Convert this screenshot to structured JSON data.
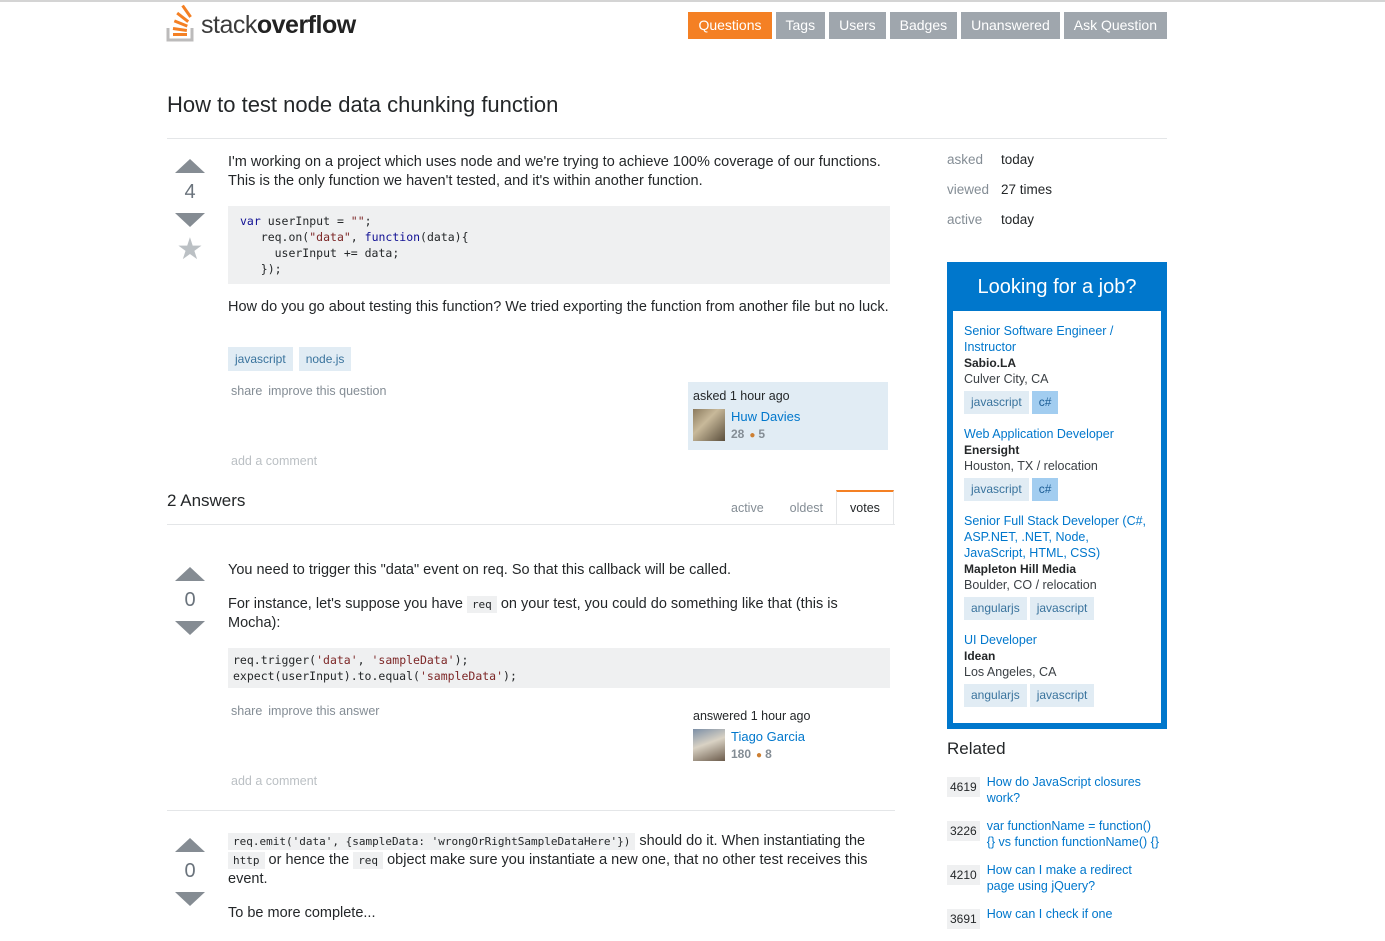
{
  "header": {
    "logo": {
      "light": "stack",
      "bold": "overflow"
    },
    "nav": [
      "Questions",
      "Tags",
      "Users",
      "Badges",
      "Unanswered",
      "Ask Question"
    ],
    "nav_active": "Questions"
  },
  "question": {
    "title": "How to test node data chunking function",
    "votes": "4",
    "body_p1": "I'm working on a project which uses node and we're trying to achieve 100% coverage of our functions. This is the only function we haven't tested, and it's within another function.",
    "code_lines": [
      "var userInput = \"\";",
      "   req.on(\"data\", function(data){",
      "     userInput += data;",
      "   });"
    ],
    "body_p2": "How do you go about testing this function? We tried exporting the function from another file but no luck.",
    "tags": [
      "javascript",
      "node.js"
    ],
    "menu": [
      "share",
      "improve this question"
    ],
    "asked_label": "asked",
    "asked_time": "1 hour ago",
    "user": {
      "name": "Huw Davies",
      "rep": "28",
      "bronze": "5"
    },
    "add_comment": "add a comment"
  },
  "answers_header": {
    "count_label": "2 Answers",
    "tabs": [
      "active",
      "oldest",
      "votes"
    ],
    "active_tab": "votes"
  },
  "answer1": {
    "votes": "0",
    "p1": "You need to trigger this \"data\" event on req. So that this callback will be called.",
    "p2_before": "For instance, let's suppose you have",
    "p2_code": "req",
    "p2_after": "on your test, you could do something like that (this is Mocha):",
    "code_lines": [
      "req.trigger('data', 'sampleData');",
      "expect(userInput).to.equal('sampleData');"
    ],
    "menu": [
      "share",
      "improve this answer"
    ],
    "answered_label": "answered",
    "answered_time": "1 hour ago",
    "user": {
      "name": "Tiago Garcia",
      "rep": "180",
      "bronze": "8"
    },
    "add_comment": "add a comment"
  },
  "answer2": {
    "votes": "0",
    "code1": "req.emit('data', {sampleData: 'wrongOrRightSampleDataHere'})",
    "t1": "should do it. When instantiating the",
    "code2": "http",
    "t2": "or hence the",
    "code3": "req",
    "t3": "object make sure you instantiate a new one, that no other test receives this event.",
    "p2": "To be more complete..."
  },
  "sidebar": {
    "info": [
      {
        "label": "asked",
        "value": "today"
      },
      {
        "label": "viewed",
        "value": "27 times"
      },
      {
        "label": "active",
        "value": "today"
      }
    ],
    "jobs_title": "Looking for a job?",
    "jobs": [
      {
        "title": "Senior Software Engineer / Instructor",
        "company": "Sabio.LA",
        "location": "Culver City, CA",
        "tags": [
          "javascript",
          "c#"
        ]
      },
      {
        "title": "Web Application Developer",
        "company": "Enersight",
        "location": "Houston, TX / relocation",
        "tags": [
          "javascript",
          "c#"
        ]
      },
      {
        "title": "Senior Full Stack Developer (C#, ASP.NET, .NET, Node, JavaScript, HTML, CSS)",
        "company": "Mapleton Hill Media",
        "location": "Boulder, CO / relocation",
        "tags": [
          "angularjs",
          "javascript"
        ]
      },
      {
        "title": "UI Developer",
        "company": "Idean",
        "location": "Los Angeles, CA",
        "tags": [
          "angularjs",
          "javascript"
        ]
      }
    ],
    "related_title": "Related",
    "related": [
      {
        "score": "4619",
        "title": "How do JavaScript closures work?"
      },
      {
        "score": "3226",
        "title": "var functionName = function() {} vs function functionName() {}"
      },
      {
        "score": "4210",
        "title": "How can I make a redirect page using jQuery?"
      },
      {
        "score": "3691",
        "title": "How can I check if one"
      }
    ]
  },
  "colors": {
    "accent": "#f48024",
    "link": "#0077cc",
    "tag_bg": "#e1ecf4",
    "nav_bg": "#9fa6ad"
  }
}
